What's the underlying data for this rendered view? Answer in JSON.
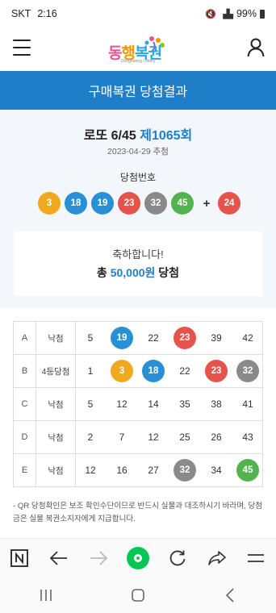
{
  "status": {
    "carrier": "SKT",
    "time": "2:16",
    "battery": "99%"
  },
  "header": {
    "logo_main": [
      "동",
      "행",
      "복권"
    ],
    "logo_sub": "Donghaeng Lottery"
  },
  "title_bar": "구매복권 당첨결과",
  "draw": {
    "name": "로또 6/45",
    "round": "제1065회",
    "date": "2023-04-29 추첨",
    "win_label": "당첨번호",
    "numbers": [
      "3",
      "18",
      "19",
      "23",
      "32",
      "45"
    ],
    "plus": "+",
    "bonus": "24"
  },
  "result": {
    "congrats": "축하합니다!",
    "prize_prefix": "총",
    "prize_amount": "50,000원",
    "prize_suffix": "당첨"
  },
  "ticket": [
    {
      "game": "A",
      "rank": "낙첨",
      "nums": [
        "5",
        "19",
        "22",
        "23",
        "39",
        "42"
      ]
    },
    {
      "game": "B",
      "rank": "4등당첨",
      "nums": [
        "1",
        "3",
        "18",
        "22",
        "23",
        "32"
      ]
    },
    {
      "game": "C",
      "rank": "낙첨",
      "nums": [
        "5",
        "12",
        "14",
        "35",
        "38",
        "41"
      ]
    },
    {
      "game": "D",
      "rank": "낙첨",
      "nums": [
        "2",
        "7",
        "12",
        "25",
        "26",
        "43"
      ]
    },
    {
      "game": "E",
      "rank": "낙첨",
      "nums": [
        "12",
        "16",
        "27",
        "32",
        "34",
        "45"
      ]
    }
  ],
  "notice": "- QR 당첨확인은 보조 확인수단이므로 반드시 실물과 대조하시기 바라며, 당첨금은 실물 복권소지자에게 지급합니다.",
  "colors": {
    "accent": "#1e7fc8",
    "ball_yellow": "#f0a81f",
    "ball_blue": "#2a90d6",
    "ball_red": "#e5534b",
    "ball_gray": "#8a8a8a",
    "ball_green": "#52b34f"
  }
}
